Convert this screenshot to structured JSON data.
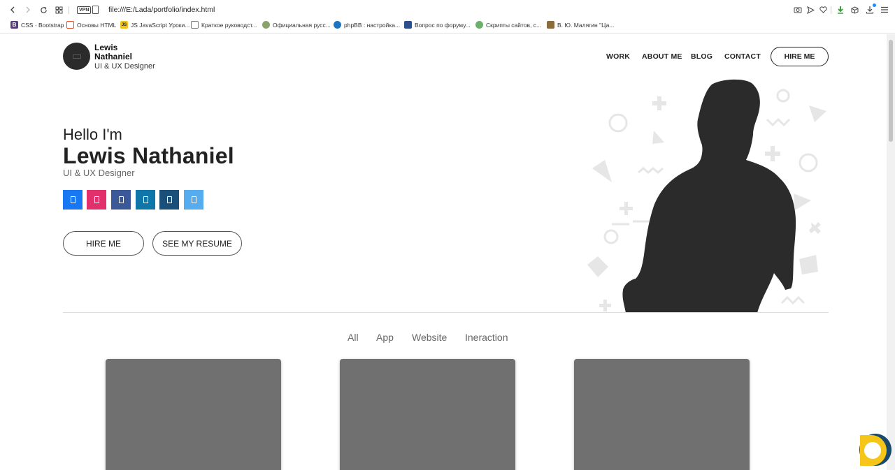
{
  "browser": {
    "url": "file:///E:/Lada/portfolio/index.html",
    "vpn_label": "VPN",
    "bookmarks": [
      {
        "label": "CSS · Bootstrap",
        "fav_letter": "B",
        "fav_color": "#563d7c"
      },
      {
        "label": "Основы HTML",
        "fav_letter": "",
        "fav_color": "#e34c26"
      },
      {
        "label": "JS JavaScript Уроки...",
        "fav_letter": "JS",
        "fav_color": "#f0c419"
      },
      {
        "label": "Краткое руководст...",
        "fav_letter": "",
        "fav_color": "#7a7a7a"
      },
      {
        "label": "Официальная русс...",
        "fav_letter": "",
        "fav_color": "#8aa36b"
      },
      {
        "label": "phpBB : настройка...",
        "fav_letter": "",
        "fav_color": "#1e73be"
      },
      {
        "label": "Вопрос по форуму...",
        "fav_letter": "",
        "fav_color": "#2c4f8c"
      },
      {
        "label": "Скрипты сайтов, с...",
        "fav_letter": "",
        "fav_color": "#6bb06b"
      },
      {
        "label": "В. Ю. Малягин \"Ца...",
        "fav_letter": "",
        "fav_color": "#8a6d3b"
      }
    ]
  },
  "header": {
    "logo_first": "Lewis",
    "logo_last": "Nathaniel",
    "logo_role": "UI & UX Designer",
    "nav": [
      "WORK",
      "ABOUT ME",
      "BLOG",
      "CONTACT"
    ],
    "hire_button": "HIRE ME"
  },
  "hero": {
    "greeting": "Hello I'm",
    "name": "Lewis Nathaniel",
    "role": "UI & UX Designer",
    "socials": [
      {
        "name": "facebook",
        "color": "#1877f2"
      },
      {
        "name": "instagram",
        "color": "#e1306c"
      },
      {
        "name": "facebook-square",
        "color": "#3b5998"
      },
      {
        "name": "linkedin",
        "color": "#0e76a8"
      },
      {
        "name": "vk",
        "color": "#1a4f7a"
      },
      {
        "name": "twitter",
        "color": "#55acee"
      }
    ],
    "hire_button": "HIRE ME",
    "resume_button": "SEE MY RESUME"
  },
  "portfolio": {
    "filters": [
      "All",
      "App",
      "Website",
      "Ineraction"
    ],
    "card_count": 3
  }
}
